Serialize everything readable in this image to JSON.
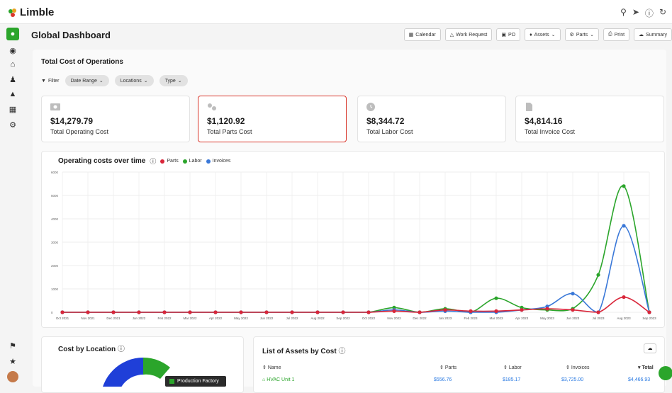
{
  "app": {
    "name": "Limble"
  },
  "header": {
    "title": "Global Dashboard"
  },
  "toolbar": {
    "calendar": "Calendar",
    "work_request": "Work Request",
    "po": "PO",
    "assets": "Assets",
    "parts": "Parts",
    "print": "Print",
    "summary": "Summary"
  },
  "section": {
    "title": "Total Cost of Operations"
  },
  "filters": {
    "label": "Filter",
    "date_range": "Date Range",
    "locations": "Locations",
    "type": "Type"
  },
  "cards": [
    {
      "value": "$14,279.79",
      "label": "Total Operating Cost",
      "icon": "money-icon"
    },
    {
      "value": "$1,120.92",
      "label": "Total Parts Cost",
      "icon": "gears-icon"
    },
    {
      "value": "$8,344.72",
      "label": "Total Labor Cost",
      "icon": "clock-icon"
    },
    {
      "value": "$4,814.16",
      "label": "Total Invoice Cost",
      "icon": "document-icon"
    }
  ],
  "chart_data": {
    "type": "line",
    "title": "Operating costs over time",
    "x": [
      "Oct 2021",
      "Nov 2021",
      "Dec 2021",
      "Jan 2022",
      "Feb 2022",
      "Mar 2022",
      "Apr 2022",
      "May 2022",
      "Jun 2022",
      "Jul 2022",
      "Aug 2022",
      "Sep 2022",
      "Oct 2022",
      "Nov 2022",
      "Dec 2022",
      "Jan 2023",
      "Feb 2023",
      "Mar 2023",
      "Apr 2023",
      "May 2023",
      "Jun 2023",
      "Jul 2023",
      "Aug 2023",
      "Sep 2023"
    ],
    "series": [
      {
        "name": "Parts",
        "color": "#d9263a",
        "values": [
          0,
          0,
          0,
          0,
          0,
          0,
          0,
          0,
          0,
          0,
          0,
          0,
          0,
          0,
          0,
          0,
          0,
          0,
          0,
          0,
          0,
          0,
          0,
          0
        ]
      },
      {
        "name": "Labor",
        "color": "#2ba52b",
        "values": [
          0,
          0,
          0,
          0,
          0,
          0,
          0,
          0,
          0,
          0,
          0,
          0,
          0,
          200,
          0,
          150,
          0,
          600,
          200,
          100,
          150,
          1600,
          5400,
          0
        ]
      },
      {
        "name": "Invoices",
        "color": "#3a78d8",
        "values": [
          0,
          0,
          0,
          0,
          0,
          0,
          0,
          0,
          0,
          0,
          0,
          0,
          0,
          100,
          0,
          50,
          0,
          0,
          100,
          250,
          800,
          0,
          3700,
          0
        ]
      }
    ],
    "series_override": [],
    "ylim": [
      0,
      6000
    ],
    "yticks": [
      "6000",
      "5000",
      "4000",
      "3000",
      "2000",
      "1000",
      "0"
    ],
    "grid": true,
    "legend": "top-left"
  },
  "parts_extra": [
    0,
    0,
    0,
    0,
    0,
    0,
    0,
    0,
    0,
    0,
    0,
    0,
    0,
    50,
    0,
    100,
    50,
    50,
    100,
    150,
    100,
    0,
    650,
    0
  ],
  "location_box": {
    "title": "Cost by Location",
    "tooltip": "Production Factory"
  },
  "assets_box": {
    "title": "List of Assets by Cost",
    "columns": [
      "Name",
      "Parts",
      "Labor",
      "Invoices",
      "Total"
    ],
    "rows": [
      {
        "name": "HVAC Unit 1",
        "parts": "$556.76",
        "labor": "$185.17",
        "invoices": "$3,725.00",
        "total": "$4,466.93"
      }
    ]
  }
}
